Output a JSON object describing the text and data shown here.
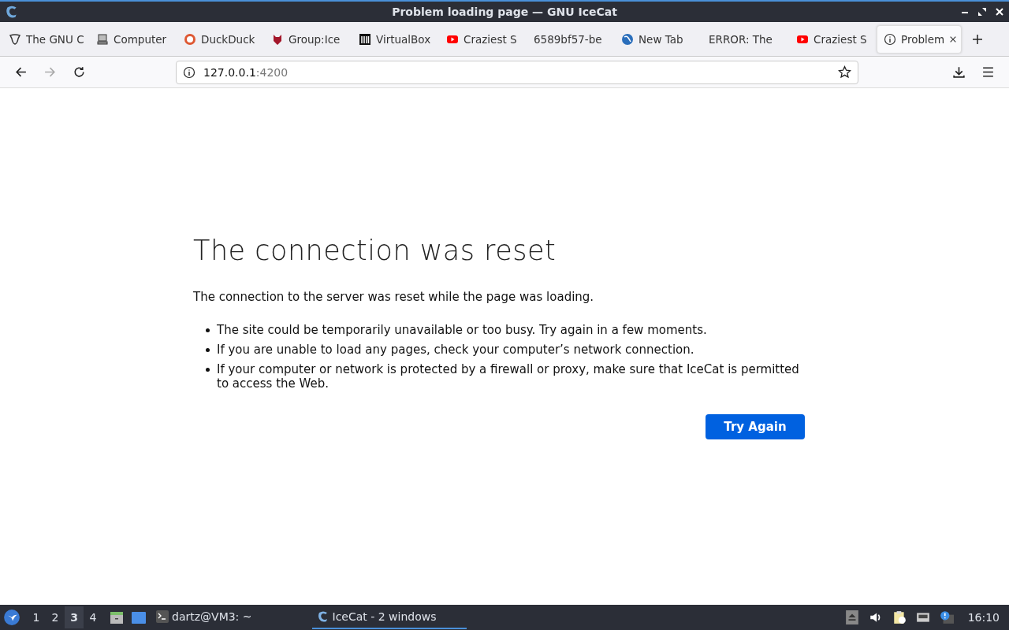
{
  "window": {
    "title": "Problem loading page — GNU IceCat"
  },
  "tabs": [
    {
      "label": "The GNU C",
      "kind": "gnu",
      "selected": false
    },
    {
      "label": "Computer",
      "kind": "computer",
      "selected": false
    },
    {
      "label": "DuckDuck",
      "kind": "duck",
      "selected": false
    },
    {
      "label": "Group:Ice",
      "kind": "group",
      "selected": false
    },
    {
      "label": "VirtualBox",
      "kind": "vbox",
      "selected": false
    },
    {
      "label": "Craziest S",
      "kind": "video",
      "selected": false
    },
    {
      "label": "6589bf57-be",
      "kind": "plain",
      "selected": false
    },
    {
      "label": "New Tab",
      "kind": "globe",
      "selected": false
    },
    {
      "label": "ERROR: The",
      "kind": "plain",
      "selected": false
    },
    {
      "label": "Craziest S",
      "kind": "video",
      "selected": false
    },
    {
      "label": "Problem",
      "kind": "info",
      "selected": true
    }
  ],
  "address": {
    "host": "127.0.0.1",
    "port": ":4200"
  },
  "error": {
    "heading": "The connection was reset",
    "summary": "The connection to the server was reset while the page was loading.",
    "bullets": [
      "The site could be temporarily unavailable or too busy. Try again in a few moments.",
      "If you are unable to load any pages, check your computer’s network connection.",
      "If your computer or network is protected by a firewall or proxy, make sure that IceCat is permitted to access the Web."
    ],
    "button": "Try Again"
  },
  "taskbar": {
    "workspaces": [
      {
        "label": "1",
        "selected": false
      },
      {
        "label": "2",
        "selected": false
      },
      {
        "label": "3",
        "selected": true
      },
      {
        "label": "4",
        "selected": false
      }
    ],
    "tasks": [
      {
        "label": "dartz@VM3: ~",
        "kind": "terminal",
        "selected": false
      },
      {
        "label": "IceCat - 2 windows",
        "kind": "browser",
        "selected": true
      }
    ],
    "clock": "16:10"
  }
}
